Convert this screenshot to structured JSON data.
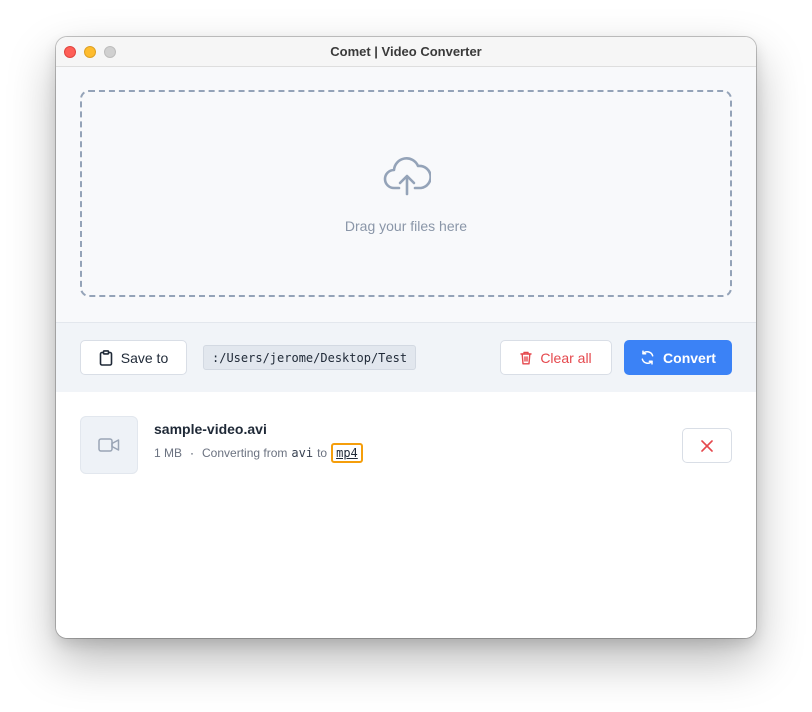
{
  "window": {
    "title": "Comet | Video Converter"
  },
  "dropzone": {
    "icon": "cloud-upload-icon",
    "text": "Drag your files here"
  },
  "toolbar": {
    "save_to_label": "Save to",
    "save_to_icon": "clipboard-icon",
    "save_path": ":/Users/jerome/Desktop/Test",
    "clear_all_label": "Clear all",
    "clear_all_icon": "trash-icon",
    "convert_label": "Convert",
    "convert_icon": "refresh-icon"
  },
  "files": [
    {
      "name": "sample-video.avi",
      "size": "1 MB",
      "separator": "·",
      "status_prefix": "Converting from",
      "from_format": "avi",
      "to_label": "to",
      "to_format": "mp4",
      "icon": "video-camera-icon",
      "remove_icon": "close-icon"
    }
  ],
  "colors": {
    "accent": "#3b82f6",
    "danger": "#e5484d",
    "focus": "#f59e0b",
    "dropzone_border": "#94a3b8"
  }
}
